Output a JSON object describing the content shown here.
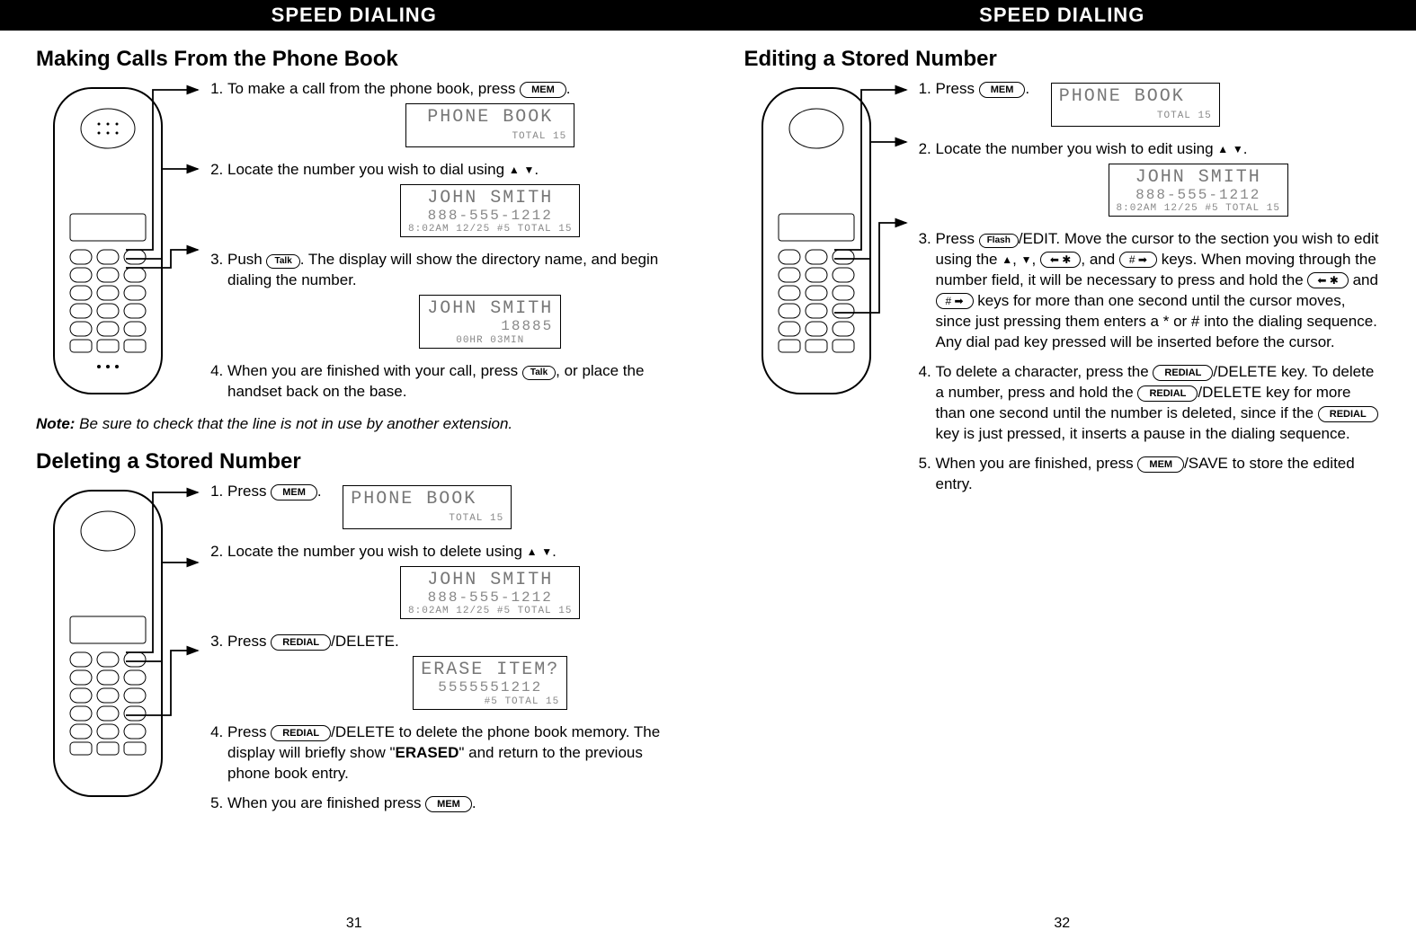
{
  "left": {
    "banner": "SPEED DIALING",
    "pagenum": "31",
    "section1": {
      "title": "Making Calls From the Phone Book",
      "steps": {
        "s1a": "To make a call from the phone book, press ",
        "s1b": ".",
        "s2a": "Locate the number you wish to dial using ",
        "s2b": ".",
        "s3a": "Push ",
        "s3b": ".  The display will show the directory name, and begin dialing the number.",
        "s4a": "When you are finished with your call, press ",
        "s4b": ", or place the handset back on the base."
      },
      "lcd1": {
        "l1": "PHONE BOOK",
        "l3": "TOTAL 15"
      },
      "lcd2": {
        "l1": "JOHN SMITH",
        "l2": "888-555-1212",
        "l3": "8:02AM 12/25  #5  TOTAL 15"
      },
      "lcd3": {
        "l1": "JOHN SMITH",
        "l2": "18885",
        "l3": "00HR 03MIN"
      },
      "note_label": "Note:",
      "note_text": "  Be sure to check that the line is not in use by another extension."
    },
    "section2": {
      "title": "Deleting a Stored Number",
      "steps": {
        "s1a": "Press ",
        "s1b": ".",
        "s2a": "Locate the number you wish to delete using ",
        "s2b": ".",
        "s3a": "Press ",
        "s3b": "/DELETE.",
        "s4a": "Press ",
        "s4b": "/DELETE to delete the phone book memory.  The display will briefly show \"",
        "s4c": "ERASED",
        "s4d": "\" and return to the previous phone book entry.",
        "s5a": "When you are finished press ",
        "s5b": "."
      },
      "lcd1": {
        "l1": "PHONE BOOK",
        "l3": "TOTAL 15"
      },
      "lcd2": {
        "l1": "JOHN SMITH",
        "l2": "888-555-1212",
        "l3": "8:02AM 12/25  #5  TOTAL 15"
      },
      "lcd3": {
        "l1": "ERASE ITEM?",
        "l2": "5555551212",
        "l3": "#5  TOTAL 15"
      }
    }
  },
  "right": {
    "banner": "SPEED DIALING",
    "pagenum": "32",
    "section1": {
      "title": "Editing a Stored Number",
      "steps": {
        "s1a": "Press ",
        "s1b": ".",
        "s2a": "Locate the number you wish to edit using ",
        "s2b": ".",
        "s3a": "Press ",
        "s3b": "/EDIT.  Move the cursor to the section you wish to edit using the ",
        "s3c": ", ",
        "s3d": ", ",
        "s3e": ", and ",
        "s3f": " keys.  When moving through the number field, it will be necessary to press and hold the ",
        "s3g": " and ",
        "s3h": " keys for more than one second until the cursor moves, since just pressing them enters a * or # into the dialing sequence.  Any dial pad key pressed will be inserted before the cursor.",
        "s4a": "To delete a character, press the ",
        "s4b": "/DELETE key.  To delete a number, press and hold the ",
        "s4c": "/DELETE key for more than one second until the number is deleted, since if the ",
        "s4d": " key is just pressed, it inserts a pause in the dialing sequence.",
        "s5a": "When you are finished, press ",
        "s5b": "/SAVE to store the edited entry."
      },
      "lcd1": {
        "l1": "PHONE BOOK",
        "l3": "TOTAL 15"
      },
      "lcd2": {
        "l1": "JOHN SMITH",
        "l2": "888-555-1212",
        "l3": "8:02AM 12/25  #5  TOTAL 15"
      }
    }
  },
  "keys": {
    "mem": "MEM",
    "talk": "Talk",
    "redial": "REDIAL",
    "flash": "Flash",
    "up": "▲",
    "down": "▼",
    "left_star": "⬅ ✱",
    "hash_right": "# ➡"
  }
}
